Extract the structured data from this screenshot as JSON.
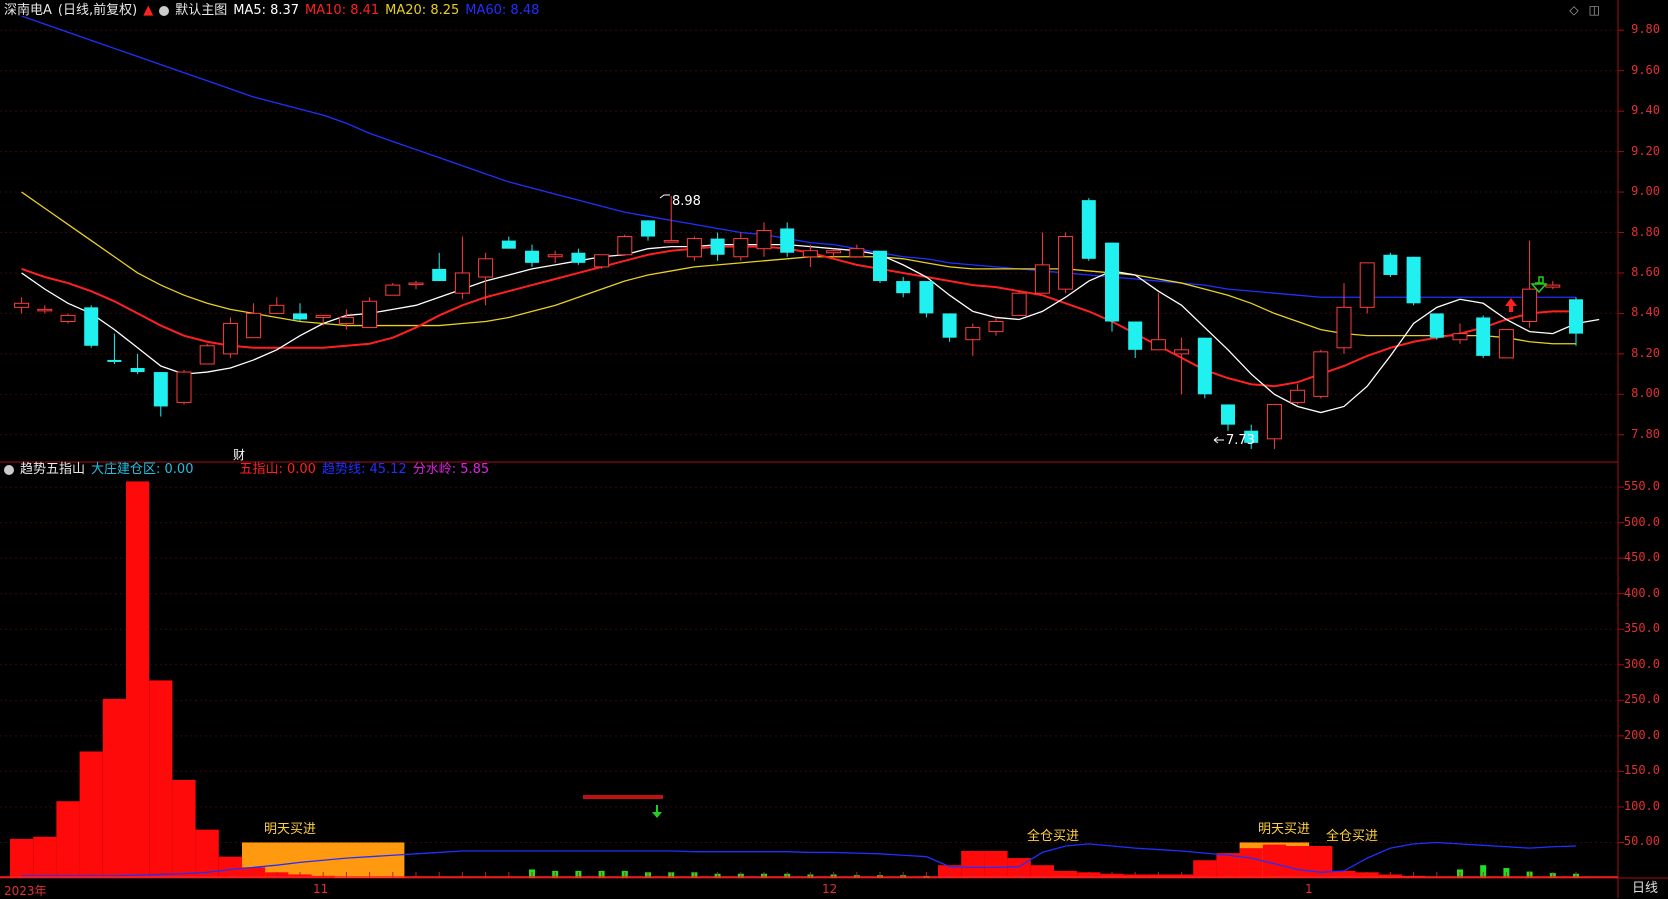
{
  "header": {
    "stock_name": "深南电A",
    "period_mode": "(日线,前复权)",
    "main_chart_label": "默认主图",
    "ma5": {
      "label": "MA5: 8.37",
      "color": "#ffffff"
    },
    "ma10": {
      "label": "MA10: 8.41",
      "color": "#ff2020"
    },
    "ma20": {
      "label": "MA20: 8.25",
      "color": "#e8d020"
    },
    "ma60": {
      "label": "MA60: 8.48",
      "color": "#2030ff"
    }
  },
  "indicator_header": {
    "name": "趋势五指山",
    "dazhuang_label": "大庄建仓区: 0.00",
    "wuzhishan_label": "五指山: 0.00",
    "trend_label": "趋势线: 45.12",
    "fenshuiling_label": "分水岭: 5.85"
  },
  "right_axis_top": [
    "9.80",
    "9.60",
    "9.40",
    "9.20",
    "9.00",
    "8.80",
    "8.60",
    "8.40",
    "8.20",
    "8.00",
    "7.80"
  ],
  "right_axis_bottom": [
    "550.0",
    "500.0",
    "450.0",
    "400.0",
    "350.0",
    "300.0",
    "250.0",
    "200.0",
    "150.0",
    "100.0",
    "50.00"
  ],
  "x_labels": [
    "2023年",
    "11",
    "12",
    "1"
  ],
  "period_button": "日线",
  "annotations": {
    "high_mark": "8.98",
    "low_mark": "7.73",
    "cai": "财",
    "mingtian1": "明天买进",
    "quancang1": "全仓买进",
    "mingtian2": "明天买进",
    "quancang2": "全仓买进"
  },
  "chart_data": {
    "type": "candlestick",
    "ylim": [
      7.7,
      9.9
    ],
    "candles": [
      [
        8.43,
        8.48,
        8.4,
        8.45
      ],
      [
        8.42,
        8.44,
        8.4,
        8.42
      ],
      [
        8.36,
        8.4,
        8.35,
        8.39
      ],
      [
        8.43,
        8.44,
        8.23,
        8.24
      ],
      [
        8.17,
        8.3,
        8.15,
        8.16
      ],
      [
        8.13,
        8.2,
        8.1,
        8.11
      ],
      [
        8.11,
        8.11,
        7.89,
        7.94
      ],
      [
        7.96,
        8.12,
        7.95,
        8.11
      ],
      [
        8.15,
        8.25,
        8.15,
        8.24
      ],
      [
        8.2,
        8.38,
        8.18,
        8.35
      ],
      [
        8.28,
        8.45,
        8.28,
        8.4
      ],
      [
        8.4,
        8.48,
        8.4,
        8.44
      ],
      [
        8.4,
        8.45,
        8.36,
        8.37
      ],
      [
        8.38,
        8.39,
        8.34,
        8.39
      ],
      [
        8.35,
        8.42,
        8.32,
        8.38
      ],
      [
        8.33,
        8.48,
        8.33,
        8.46
      ],
      [
        8.49,
        8.55,
        8.49,
        8.54
      ],
      [
        8.55,
        8.56,
        8.52,
        8.55
      ],
      [
        8.62,
        8.7,
        8.56,
        8.56
      ],
      [
        8.5,
        8.78,
        8.47,
        8.6
      ],
      [
        8.58,
        8.7,
        8.44,
        8.67
      ],
      [
        8.76,
        8.78,
        8.72,
        8.72
      ],
      [
        8.71,
        8.74,
        8.63,
        8.65
      ],
      [
        8.68,
        8.71,
        8.65,
        8.69
      ],
      [
        8.7,
        8.72,
        8.64,
        8.65
      ],
      [
        8.63,
        8.68,
        8.62,
        8.69
      ],
      [
        8.69,
        8.79,
        8.69,
        8.78
      ],
      [
        8.86,
        8.86,
        8.76,
        8.78
      ],
      [
        8.76,
        8.98,
        8.75,
        8.76
      ],
      [
        8.68,
        8.78,
        8.66,
        8.77
      ],
      [
        8.77,
        8.8,
        8.66,
        8.69
      ],
      [
        8.68,
        8.8,
        8.66,
        8.77
      ],
      [
        8.72,
        8.85,
        8.68,
        8.81
      ],
      [
        8.82,
        8.85,
        8.68,
        8.7
      ],
      [
        8.68,
        8.74,
        8.63,
        8.71
      ],
      [
        8.7,
        8.72,
        8.68,
        8.71
      ],
      [
        8.68,
        8.74,
        8.68,
        8.72
      ],
      [
        8.71,
        8.71,
        8.55,
        8.56
      ],
      [
        8.56,
        8.58,
        8.48,
        8.5
      ],
      [
        8.56,
        8.56,
        8.38,
        8.4
      ],
      [
        8.4,
        8.4,
        8.26,
        8.28
      ],
      [
        8.27,
        8.35,
        8.19,
        8.33
      ],
      [
        8.31,
        8.38,
        8.29,
        8.36
      ],
      [
        8.39,
        8.51,
        8.39,
        8.5
      ],
      [
        8.5,
        8.8,
        8.5,
        8.64
      ],
      [
        8.52,
        8.8,
        8.5,
        8.78
      ],
      [
        8.96,
        8.97,
        8.66,
        8.67
      ],
      [
        8.75,
        8.75,
        8.31,
        8.36
      ],
      [
        8.36,
        8.36,
        8.18,
        8.22
      ],
      [
        8.22,
        8.5,
        8.22,
        8.27
      ],
      [
        8.2,
        8.28,
        8.0,
        8.22
      ],
      [
        8.28,
        8.28,
        7.98,
        8.0
      ],
      [
        7.95,
        7.95,
        7.82,
        7.85
      ],
      [
        7.82,
        7.85,
        7.73,
        7.76
      ],
      [
        7.78,
        7.95,
        7.73,
        7.95
      ],
      [
        7.96,
        8.05,
        7.95,
        8.02
      ],
      [
        7.99,
        8.22,
        7.98,
        8.21
      ],
      [
        8.23,
        8.55,
        8.2,
        8.43
      ],
      [
        8.43,
        8.65,
        8.4,
        8.65
      ],
      [
        8.69,
        8.7,
        8.58,
        8.59
      ],
      [
        8.68,
        8.68,
        8.44,
        8.45
      ],
      [
        8.4,
        8.4,
        8.27,
        8.28
      ],
      [
        8.27,
        8.35,
        8.25,
        8.3
      ],
      [
        8.38,
        8.39,
        8.18,
        8.19
      ],
      [
        8.18,
        8.3,
        8.18,
        8.32
      ],
      [
        8.36,
        8.76,
        8.33,
        8.52
      ],
      [
        8.53,
        8.56,
        8.52,
        8.54
      ],
      [
        8.47,
        8.48,
        8.24,
        8.3
      ]
    ],
    "ma5": [
      8.6,
      8.52,
      8.45,
      8.4,
      8.32,
      8.23,
      8.14,
      8.1,
      8.11,
      8.13,
      8.17,
      8.22,
      8.29,
      8.35,
      8.39,
      8.4,
      8.42,
      8.44,
      8.48,
      8.52,
      8.56,
      8.59,
      8.62,
      8.64,
      8.66,
      8.68,
      8.69,
      8.72,
      8.73,
      8.73,
      8.74,
      8.74,
      8.74,
      8.74,
      8.73,
      8.72,
      8.71,
      8.69,
      8.64,
      8.58,
      8.49,
      8.41,
      8.38,
      8.37,
      8.41,
      8.48,
      8.56,
      8.61,
      8.59,
      8.51,
      8.44,
      8.33,
      8.22,
      8.1,
      8.0,
      7.94,
      7.91,
      7.94,
      8.04,
      8.19,
      8.35,
      8.43,
      8.47,
      8.45,
      8.37,
      8.31,
      8.3,
      8.35,
      8.37
    ],
    "ma10": [
      8.62,
      8.58,
      8.55,
      8.51,
      8.46,
      8.4,
      8.34,
      8.29,
      8.26,
      8.24,
      8.23,
      8.23,
      8.23,
      8.23,
      8.24,
      8.25,
      8.28,
      8.33,
      8.39,
      8.44,
      8.48,
      8.51,
      8.54,
      8.57,
      8.6,
      8.63,
      8.66,
      8.69,
      8.71,
      8.72,
      8.73,
      8.73,
      8.73,
      8.72,
      8.7,
      8.67,
      8.64,
      8.62,
      8.6,
      8.58,
      8.56,
      8.54,
      8.53,
      8.51,
      8.49,
      8.45,
      8.41,
      8.36,
      8.3,
      8.24,
      8.18,
      8.12,
      8.08,
      8.05,
      8.04,
      8.06,
      8.1,
      8.14,
      8.19,
      8.23,
      8.26,
      8.28,
      8.3,
      8.33,
      8.37,
      8.4,
      8.41,
      8.41
    ],
    "ma20": [
      9.0,
      8.92,
      8.84,
      8.76,
      8.68,
      8.6,
      8.54,
      8.49,
      8.45,
      8.42,
      8.4,
      8.38,
      8.36,
      8.35,
      8.34,
      8.34,
      8.34,
      8.34,
      8.34,
      8.35,
      8.36,
      8.38,
      8.41,
      8.44,
      8.48,
      8.52,
      8.56,
      8.59,
      8.61,
      8.63,
      8.64,
      8.65,
      8.66,
      8.67,
      8.68,
      8.68,
      8.68,
      8.68,
      8.67,
      8.65,
      8.63,
      8.62,
      8.62,
      8.62,
      8.62,
      8.62,
      8.61,
      8.6,
      8.59,
      8.57,
      8.55,
      8.52,
      8.49,
      8.45,
      8.4,
      8.36,
      8.32,
      8.3,
      8.29,
      8.29,
      8.29,
      8.29,
      8.29,
      8.29,
      8.28,
      8.26,
      8.25,
      8.25
    ],
    "ma60": [
      9.87,
      9.83,
      9.79,
      9.75,
      9.71,
      9.67,
      9.63,
      9.59,
      9.55,
      9.51,
      9.47,
      9.44,
      9.41,
      9.38,
      9.34,
      9.29,
      9.25,
      9.21,
      9.17,
      9.13,
      9.09,
      9.05,
      9.02,
      8.99,
      8.96,
      8.93,
      8.9,
      8.88,
      8.86,
      8.84,
      8.82,
      8.8,
      8.79,
      8.77,
      8.75,
      8.74,
      8.72,
      8.7,
      8.68,
      8.67,
      8.65,
      8.64,
      8.63,
      8.62,
      8.61,
      8.6,
      8.59,
      8.58,
      8.57,
      8.56,
      8.55,
      8.54,
      8.52,
      8.51,
      8.5,
      8.49,
      8.48,
      8.48,
      8.48,
      8.48,
      8.48,
      8.48,
      8.48,
      8.48,
      8.48,
      8.48,
      8.48,
      8.48
    ],
    "sub_ylim": [
      0,
      560
    ],
    "sub_red_bars": [
      55,
      58,
      108,
      178,
      252,
      558,
      278,
      138,
      68,
      30,
      15,
      8,
      5,
      3,
      0,
      0,
      0,
      0,
      0,
      0,
      0,
      0,
      0,
      0,
      0,
      0,
      0,
      0,
      0,
      0,
      0,
      0,
      0,
      0,
      0,
      0,
      0,
      0,
      0,
      0,
      18,
      38,
      38,
      28,
      18,
      10,
      8,
      6,
      5,
      5,
      5,
      25,
      35,
      42,
      47,
      45,
      45,
      10,
      8,
      5,
      3,
      2,
      2,
      2,
      2,
      2,
      2,
      2
    ],
    "sub_orange_zones": [
      [
        10,
        16,
        50
      ],
      [
        53,
        55,
        50
      ]
    ],
    "sub_green_bars": [
      0,
      0,
      0,
      0,
      0,
      0,
      0,
      0,
      0,
      0,
      0,
      0,
      0,
      0,
      0,
      0,
      0,
      0,
      0,
      0,
      0,
      0,
      12,
      10,
      10,
      10,
      10,
      8,
      8,
      8,
      6,
      6,
      6,
      6,
      5,
      5,
      4,
      4,
      4,
      3,
      0,
      0,
      0,
      0,
      0,
      0,
      0,
      0,
      0,
      0,
      0,
      0,
      0,
      0,
      0,
      0,
      0,
      0,
      0,
      0,
      0,
      0,
      12,
      18,
      14,
      9,
      7,
      6
    ],
    "sub_trend": [
      3,
      3,
      3,
      3,
      3,
      4,
      5,
      6,
      8,
      12,
      15,
      18,
      22,
      25,
      28,
      30,
      32,
      34,
      36,
      38,
      38,
      38,
      38,
      38,
      38,
      38,
      38,
      38,
      38,
      37,
      37,
      37,
      37,
      37,
      36,
      36,
      35,
      34,
      32,
      30,
      16,
      15,
      15,
      16,
      36,
      45,
      48,
      45,
      42,
      40,
      38,
      35,
      32,
      28,
      20,
      12,
      8,
      10,
      28,
      42,
      48,
      50,
      48,
      46,
      44,
      42,
      44,
      45
    ]
  }
}
